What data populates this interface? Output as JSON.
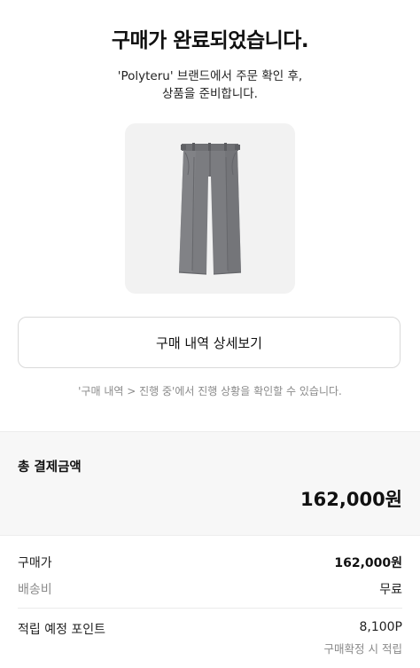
{
  "header": {
    "title": "구매가 완료되었습니다.",
    "subtitle_line1": "'Polyteru' 브랜드에서 주문 확인 후,",
    "subtitle_line2": "상품을 준비합니다."
  },
  "product": {
    "image_icon": "gray-trousers-image",
    "background_color": "#f2f2f2",
    "item_color": "#7b7c80"
  },
  "detail_button": {
    "label": "구매 내역 상세보기"
  },
  "info_note": "'구매 내역 > 진행 중'에서 진행 상황을 확인할 수 있습니다.",
  "payment": {
    "total_label": "총 결제금액",
    "total_amount": "162,000원",
    "section_background": "#f7f7f7"
  },
  "breakdown": {
    "purchase_label": "구매가",
    "purchase_value": "162,000원",
    "shipping_label": "배송비",
    "shipping_value": "무료",
    "points_label": "적립 예정 포인트",
    "points_value": "8,100P",
    "points_note": "구매확정 시 적립"
  }
}
